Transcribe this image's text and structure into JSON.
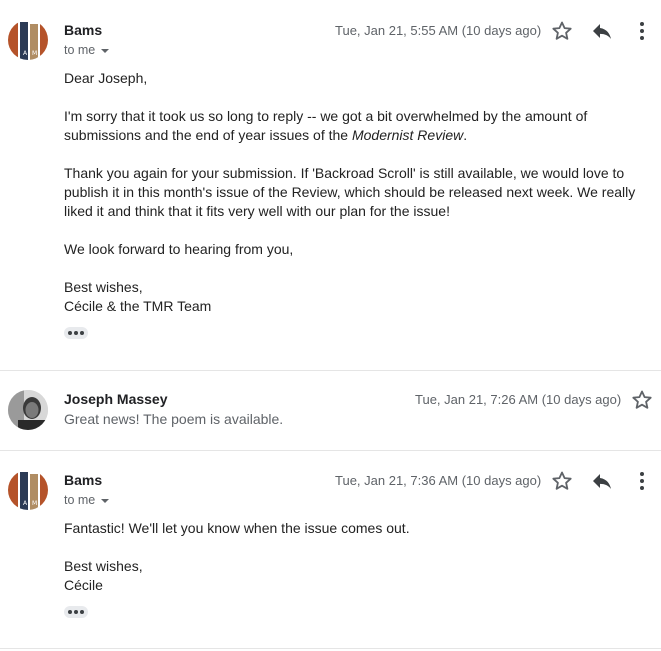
{
  "messages": [
    {
      "sender": "Bams",
      "recipient": "to me",
      "date": "Tue, Jan 21, 5:55 AM (10 days ago)",
      "greeting": "Dear Joseph,",
      "para1_pre": "I'm sorry that it took us so long to reply -- we got a bit overwhelmed by the amount of submissions and the end of year issues of the ",
      "para1_em": "Modernist Review",
      "para1_post": ".",
      "para2": "Thank you again for your submission. If 'Backroad Scroll' is still available, we would love to publish it in this month's issue of the Review, which should be released next week. We really liked it and think that it fits very well with our plan for the issue!",
      "para3": "We look forward to hearing from you,",
      "signoff": "Best wishes,",
      "signature": "Cécile & the TMR Team"
    },
    {
      "sender": "Joseph Massey",
      "date": "Tue, Jan 21, 7:26 AM (10 days ago)",
      "snippet": "Great news! The poem is available."
    },
    {
      "sender": "Bams",
      "recipient": "to me",
      "date": "Tue, Jan 21, 7:36 AM (10 days ago)",
      "para1": "Fantastic! We'll let you know when the issue comes out.",
      "signoff": "Best wishes,",
      "signature": "Cécile"
    }
  ],
  "avatar_logo_letters": "AM",
  "icons": {
    "star": "star-icon",
    "reply": "reply-icon",
    "more": "more-vert-icon",
    "caret": "caret-down-icon",
    "ellipsis": "show-trimmed-content-icon"
  },
  "colors": {
    "sender": "#202124",
    "meta": "#5f6368",
    "logo_navy": "#2b3a55",
    "logo_rust": "#b5532a",
    "logo_tan": "#b08d63"
  }
}
